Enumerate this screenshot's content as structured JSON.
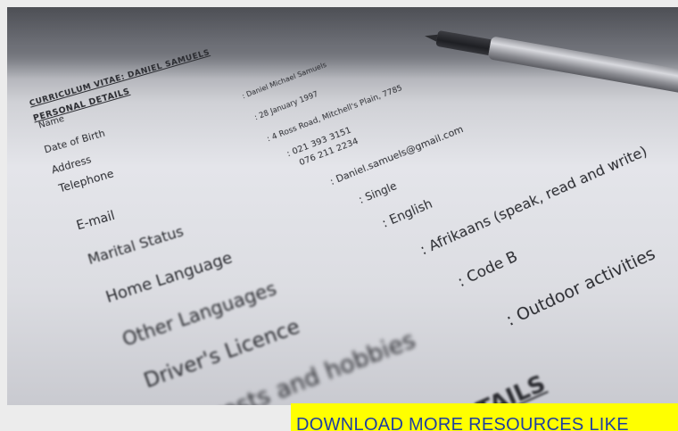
{
  "document": {
    "title": "CURRICULUM VITAE: DANIEL SAMUELS",
    "section_personal": "PERSONAL DETAILS",
    "labels": {
      "name": "Name",
      "dob": "Date of Birth",
      "address": "Address",
      "telephone": "Telephone",
      "email": "E-mail",
      "marital": "Marital Status",
      "home_language": "Home Language",
      "other_languages": "Other Languages",
      "drivers_licence": "Driver's Licence",
      "interests": "Interests and hobbies"
    },
    "values": {
      "name": ": Daniel Michael Samuels",
      "dob": ": 28 January 1997",
      "address": ": 4 Ross Road, Mitchell's Plain, 7785",
      "telephone": ": 021 393 3151",
      "telephone2": "076 211 2234",
      "email": ": Daniel.samuels@gmail.com",
      "marital": ": Single",
      "home_language": ": English",
      "other_languages": ": Afrikaans (speak, read and write)",
      "drivers_licence": ": Code B",
      "interests": ": Outdoor activities"
    },
    "next_section_partial": "TAILS"
  },
  "banner": {
    "text": "DOWNLOAD MORE RESOURCES LIKE",
    "color": "#ffff00",
    "text_color": "#1f3fa0"
  }
}
